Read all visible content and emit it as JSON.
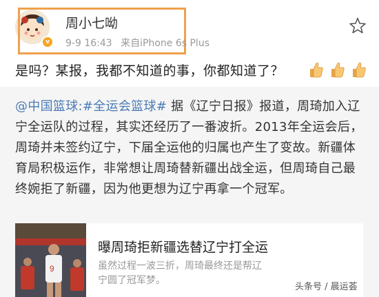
{
  "user": {
    "name": "周小七呦",
    "timestamp": "9-9 16:43",
    "source": "来自iPhone 6s Plus",
    "verified_badge": "v"
  },
  "post": {
    "text": "是吗？某报，我都不知道的事，你都知道了？"
  },
  "repost": {
    "tags": "@中国篮球:#全运会篮球#",
    "body": " 据《辽宁日报》报道，周琦加入辽宁全运队的过程，其实还经历了一番波折。2013年全运会后，周琦并未签约辽宁，下届全运他的归属也产生了变故。新疆体育局积极运作，非常想让周琦替新疆出战全运，但周琦自己最终婉拒了新疆，因为他更想为辽宁再拿一个冠军。"
  },
  "card": {
    "title": "曝周琦拒新疆选替辽宁打全运",
    "desc": "虽然过程一波三折，周琦最终还是帮辽宁圆了冠军梦。"
  },
  "watermark": "头条号 / 晨运荟",
  "icons": {
    "star": "star-outline-icon",
    "thumbs": "thumbs-up-emoji"
  },
  "colors": {
    "highlight": "#f0a04b",
    "link": "#4a7ab5",
    "repost_bg": "#f5f5f5"
  }
}
